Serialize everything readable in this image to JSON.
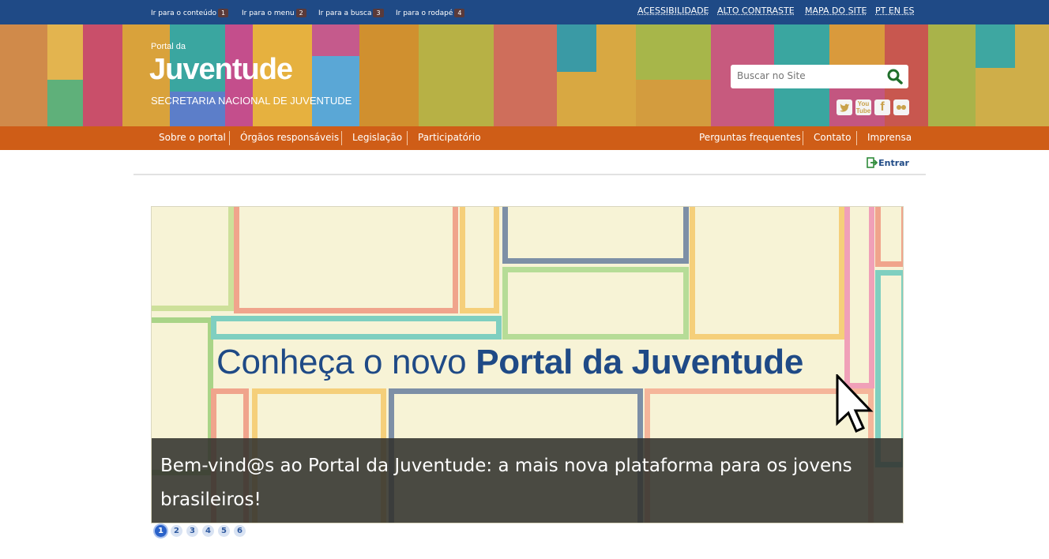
{
  "skip_links": [
    {
      "label": "Ir para o conteúdo",
      "key": "1"
    },
    {
      "label": "Ir para o menu",
      "key": "2"
    },
    {
      "label": "Ir para a busca",
      "key": "3"
    },
    {
      "label": "Ir para o rodapé",
      "key": "4"
    }
  ],
  "accessibility_links": [
    "ACESSIBILIDADE",
    "ALTO CONTRASTE",
    "MAPA DO SITE",
    "PT EN ES"
  ],
  "header": {
    "small_title": "Portal da",
    "big_title": "Juventude",
    "subtitle": "SECRETARIA NACIONAL DE JUVENTUDE"
  },
  "search": {
    "placeholder": "Buscar no Site",
    "icon": "search-icon"
  },
  "social_icons": [
    "twitter-icon",
    "youtube-icon",
    "facebook-icon",
    "flickr-icon"
  ],
  "nav_left": [
    "Sobre o portal",
    "Órgãos responsáveis",
    "Legislação",
    "Participatório"
  ],
  "nav_right": [
    "Perguntas frequentes",
    "Contato",
    "Imprensa"
  ],
  "login": {
    "label": "Entrar",
    "icon": "login-icon"
  },
  "slide": {
    "headline_regular": "Conheça o novo ",
    "headline_bold": "Portal da Juventude",
    "caption": "Bem-vind@s ao Portal da Juventude: a mais nova plataforma para os jovens brasileiros!"
  },
  "pager": {
    "pages": [
      "1",
      "2",
      "3",
      "4",
      "5",
      "6"
    ],
    "active": "1"
  },
  "colors": {
    "topbar": "#1f4a86",
    "nav": "#cf5d17",
    "headline": "#1f4a86"
  }
}
